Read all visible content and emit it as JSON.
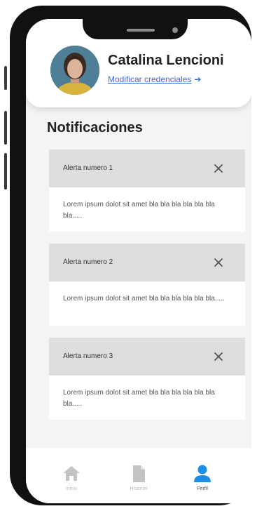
{
  "profile": {
    "name": "Catalina Lencioni",
    "edit_link": "Modificar credenciales",
    "edit_arrow": "➔"
  },
  "notifications": {
    "title": "Notificaciones",
    "close_glyph": "close-icon",
    "items": [
      {
        "title": "Alerta numero 1",
        "body": "Lorem ipsum dolot sit amet bla bla bla bla bla bla bla....."
      },
      {
        "title": "Alerta numero 2",
        "body": "Lorem ipsum dolot sit amet bla bla bla bla bla bla....."
      },
      {
        "title": "Alerta numero 3",
        "body": "Lorem ipsum dolot sit amet bla bla bla bla bla bla bla....."
      }
    ]
  },
  "tabbar": {
    "items": [
      {
        "label": "Inicio",
        "icon": "home-icon",
        "active": false
      },
      {
        "label": "Historial",
        "icon": "document-icon",
        "active": false
      },
      {
        "label": "Perfil",
        "icon": "person-icon",
        "active": true
      }
    ]
  },
  "colors": {
    "accent": "#1a8fe3",
    "link": "#3a6fd2",
    "inactive_icon": "#c4c4c4",
    "alert_header": "#dedede"
  }
}
